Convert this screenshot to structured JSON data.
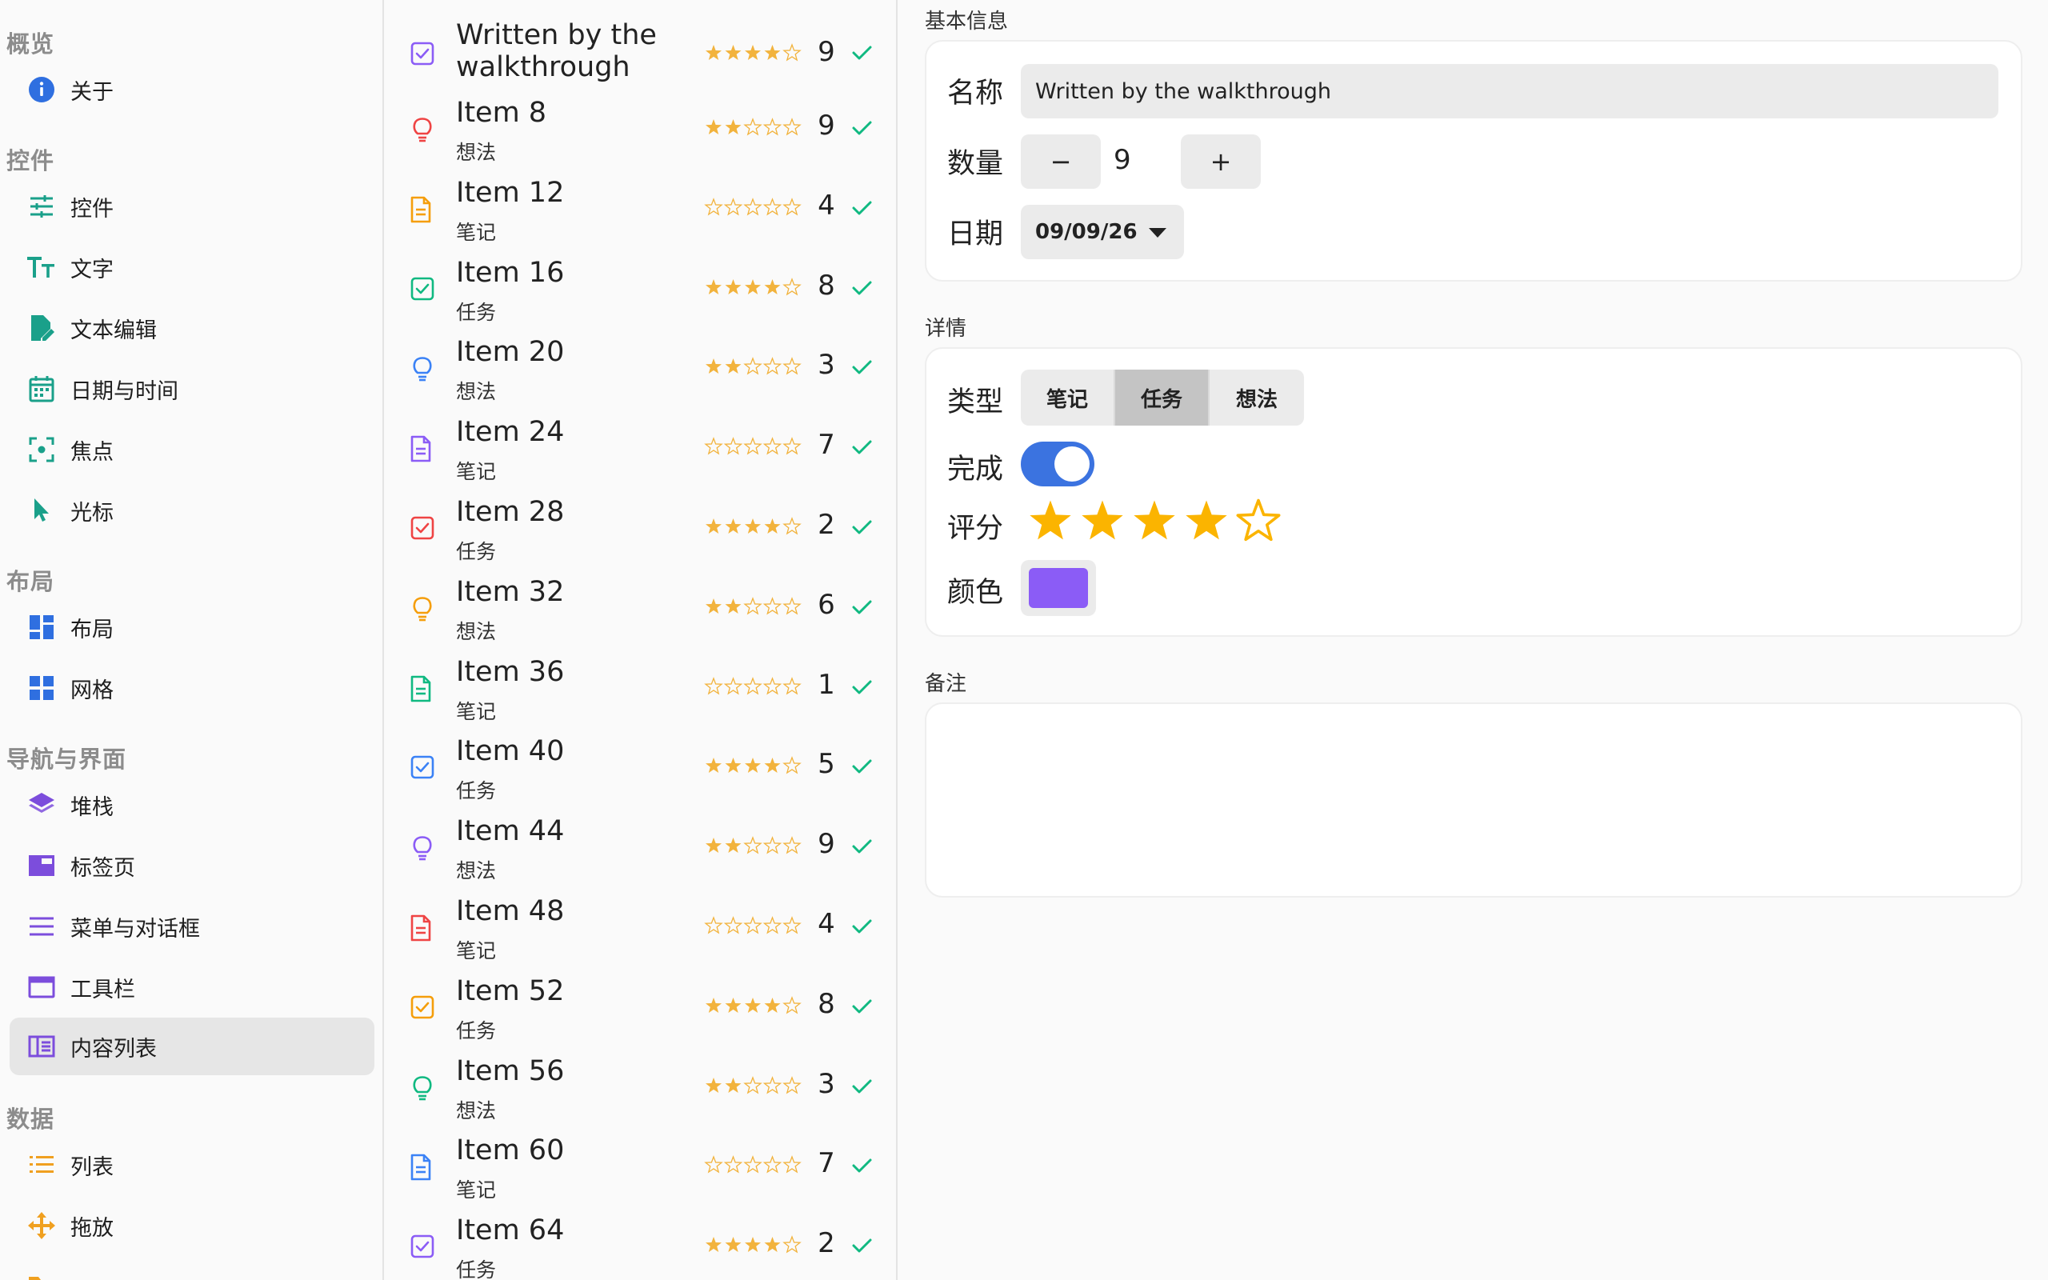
{
  "sidebar": {
    "sections": [
      {
        "title": "概览",
        "items": [
          {
            "label": "关于",
            "icon": "info-icon"
          }
        ]
      },
      {
        "title": "控件",
        "items": [
          {
            "label": "控件",
            "icon": "sliders-icon"
          },
          {
            "label": "文字",
            "icon": "text-size-icon"
          },
          {
            "label": "文本编辑",
            "icon": "document-edit-icon"
          },
          {
            "label": "日期与时间",
            "icon": "calendar-icon"
          },
          {
            "label": "焦点",
            "icon": "focus-icon"
          },
          {
            "label": "光标",
            "icon": "cursor-icon"
          }
        ]
      },
      {
        "title": "布局",
        "items": [
          {
            "label": "布局",
            "icon": "layout-icon"
          },
          {
            "label": "网格",
            "icon": "grid-icon"
          }
        ]
      },
      {
        "title": "导航与界面",
        "items": [
          {
            "label": "堆栈",
            "icon": "stack-icon"
          },
          {
            "label": "标签页",
            "icon": "tabs-icon"
          },
          {
            "label": "菜单与对话框",
            "icon": "menu-icon"
          },
          {
            "label": "工具栏",
            "icon": "toolbar-icon"
          },
          {
            "label": "内容列表",
            "icon": "content-list-icon",
            "selected": true
          }
        ]
      },
      {
        "title": "数据",
        "items": [
          {
            "label": "列表",
            "icon": "list-icon"
          },
          {
            "label": "拖放",
            "icon": "drag-drop-icon"
          },
          {
            "label": "",
            "icon": "folder-icon"
          }
        ]
      }
    ]
  },
  "list": {
    "items": [
      {
        "title": "Written by the walkthrough",
        "subtitle": "",
        "kind": "task",
        "color": "#8b5cf6",
        "stars": 4,
        "count": "9"
      },
      {
        "title": "Item 8",
        "subtitle": "想法",
        "kind": "idea",
        "color": "#ef4444",
        "stars": 2,
        "count": "9"
      },
      {
        "title": "Item 12",
        "subtitle": "笔记",
        "kind": "note",
        "color": "#f59e0b",
        "stars": 0,
        "count": "4"
      },
      {
        "title": "Item 16",
        "subtitle": "任务",
        "kind": "task",
        "color": "#10b981",
        "stars": 4,
        "count": "8"
      },
      {
        "title": "Item 20",
        "subtitle": "想法",
        "kind": "idea",
        "color": "#3b82f6",
        "stars": 2,
        "count": "3"
      },
      {
        "title": "Item 24",
        "subtitle": "笔记",
        "kind": "note",
        "color": "#8b5cf6",
        "stars": 0,
        "count": "7"
      },
      {
        "title": "Item 28",
        "subtitle": "任务",
        "kind": "task",
        "color": "#ef4444",
        "stars": 4,
        "count": "2"
      },
      {
        "title": "Item 32",
        "subtitle": "想法",
        "kind": "idea",
        "color": "#f59e0b",
        "stars": 2,
        "count": "6"
      },
      {
        "title": "Item 36",
        "subtitle": "笔记",
        "kind": "note",
        "color": "#10b981",
        "stars": 0,
        "count": "1"
      },
      {
        "title": "Item 40",
        "subtitle": "任务",
        "kind": "task",
        "color": "#3b82f6",
        "stars": 4,
        "count": "5"
      },
      {
        "title": "Item 44",
        "subtitle": "想法",
        "kind": "idea",
        "color": "#8b5cf6",
        "stars": 2,
        "count": "9"
      },
      {
        "title": "Item 48",
        "subtitle": "笔记",
        "kind": "note",
        "color": "#ef4444",
        "stars": 0,
        "count": "4"
      },
      {
        "title": "Item 52",
        "subtitle": "任务",
        "kind": "task",
        "color": "#f59e0b",
        "stars": 4,
        "count": "8"
      },
      {
        "title": "Item 56",
        "subtitle": "想法",
        "kind": "idea",
        "color": "#10b981",
        "stars": 2,
        "count": "3"
      },
      {
        "title": "Item 60",
        "subtitle": "笔记",
        "kind": "note",
        "color": "#3b82f6",
        "stars": 0,
        "count": "7"
      },
      {
        "title": "Item 64",
        "subtitle": "任务",
        "kind": "task",
        "color": "#8b5cf6",
        "stars": 4,
        "count": "2"
      }
    ]
  },
  "detail": {
    "basic": {
      "title": "基本信息",
      "name_label": "名称",
      "name_value": "Written by the walkthrough",
      "qty_label": "数量",
      "qty_minus": "−",
      "qty_value": "9",
      "qty_plus": "+",
      "date_label": "日期",
      "date_value": "09/09/26"
    },
    "info": {
      "title": "详情",
      "type_label": "类型",
      "type_options": [
        "笔记",
        "任务",
        "想法"
      ],
      "type_selected": "任务",
      "done_label": "完成",
      "done_value": true,
      "rating_label": "评分",
      "rating_value": 4,
      "rating_max": 5,
      "color_label": "颜色",
      "color_value": "#8b5cf6"
    },
    "notes": {
      "title": "备注",
      "value": ""
    }
  },
  "colors": {
    "accent_green": "#10b981",
    "star_gold": "#fbb400",
    "toggle_blue": "#3b73e0",
    "selected_bg": "#e6e6e6"
  }
}
